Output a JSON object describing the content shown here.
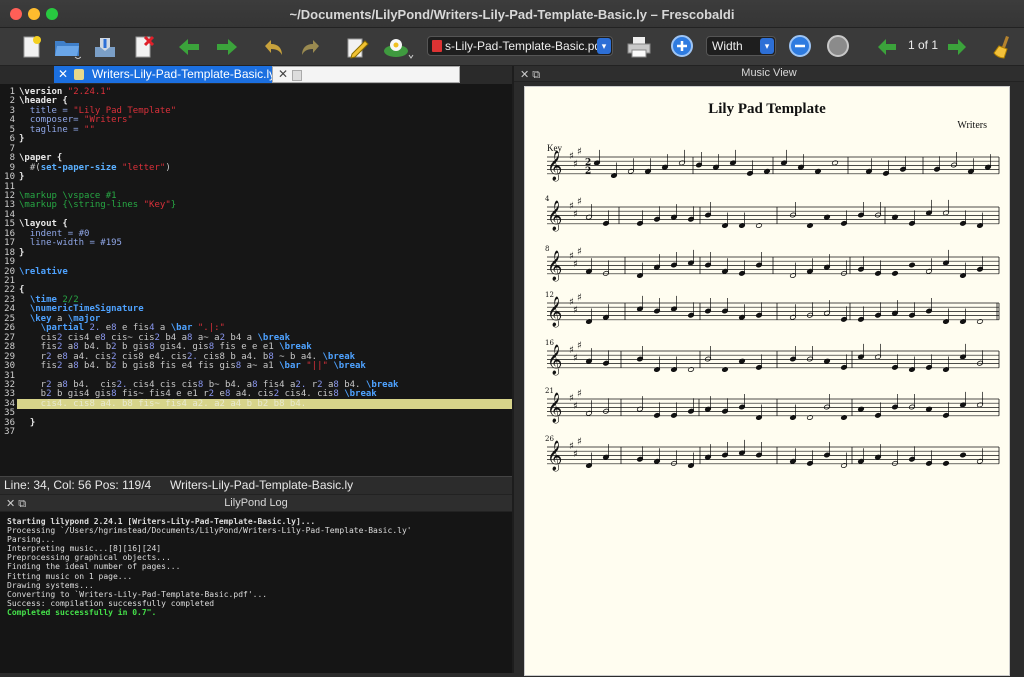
{
  "window": {
    "title": "~/Documents/LilyPond/Writers-Lily-Pad-Template-Basic.ly – Frescobaldi"
  },
  "toolbar": {
    "icons": [
      "new-document-icon",
      "open-folder-icon",
      "save-icon",
      "close-document-icon",
      "back-arrow-icon",
      "forward-arrow-icon",
      "undo-icon",
      "redo-icon",
      "edit-pencil-icon",
      "lilypond-run-icon",
      "print-icon",
      "zoom-in-icon",
      "zoom-out-icon",
      "zoom-original-icon",
      "prev-page-icon",
      "next-page-icon",
      "broom-icon"
    ],
    "document_select": "s-Lily-Pad-Template-Basic.pdf",
    "zoom_select": "Width",
    "page_indicator": "1 of 1"
  },
  "editor": {
    "tab_label": "Writers-Lily-Pad-Template-Basic.ly",
    "current_line": 34,
    "line_numbers": [
      "1",
      "2",
      "3",
      "4",
      "5",
      "6",
      "7",
      "8",
      "9",
      "10",
      "11",
      "12",
      "13",
      "14",
      "15",
      "16",
      "17",
      "18",
      "19",
      "20",
      "21",
      "22",
      "23",
      "24",
      "25",
      "26",
      "27",
      "28",
      "29",
      "30",
      "31",
      "32",
      "33",
      "34",
      "35",
      "36",
      "37"
    ],
    "lines": [
      [
        [
          "k",
          "\\version "
        ],
        [
          "s",
          "\"2.24.1\""
        ]
      ],
      [
        [
          "k",
          "\\header {"
        ]
      ],
      [
        [
          "v",
          "  title = "
        ],
        [
          "s",
          "\"Lily Pad Template\""
        ]
      ],
      [
        [
          "v",
          "  composer= "
        ],
        [
          "s",
          "\"Writers\""
        ]
      ],
      [
        [
          "v",
          "  tagline = "
        ],
        [
          "s",
          "\"\""
        ]
      ],
      [
        [
          "k",
          "}"
        ]
      ],
      [],
      [
        [
          "k",
          "\\paper {"
        ]
      ],
      [
        [
          "n",
          "  #("
        ],
        [
          "fn",
          "set-paper-size"
        ],
        [
          "s",
          " \"letter\""
        ],
        [
          "n",
          ")"
        ]
      ],
      [
        [
          "k",
          "}"
        ]
      ],
      [],
      [
        [
          "c",
          "\\markup \\vspace #1"
        ]
      ],
      [
        [
          "c",
          "\\markup {"
        ],
        [
          "c",
          "\\string-lines "
        ],
        [
          "s",
          "\"Key\""
        ],
        [
          "c",
          "}"
        ]
      ],
      [],
      [
        [
          "k",
          "\\layout {"
        ]
      ],
      [
        [
          "v",
          "  indent = #0"
        ]
      ],
      [
        [
          "v",
          "  line-width = #195"
        ]
      ],
      [
        [
          "k",
          "}"
        ]
      ],
      [],
      [
        [
          "kw",
          "\\relative"
        ]
      ],
      [],
      [
        [
          "k",
          "{"
        ]
      ],
      [
        [
          "kw",
          "  \\time "
        ],
        [
          "c",
          "2/2"
        ]
      ],
      [
        [
          "kw",
          "  \\numericTimeSignature"
        ]
      ],
      [
        [
          "kw",
          "  \\key "
        ],
        [
          "n",
          "a "
        ],
        [
          "kw",
          "\\major"
        ]
      ],
      [
        [
          "kw",
          "    \\partial "
        ],
        [
          "p",
          "2. "
        ],
        [
          "n",
          "e"
        ],
        [
          "p",
          "8 "
        ],
        [
          "n",
          "e fis"
        ],
        [
          "p",
          "4 "
        ],
        [
          "n",
          "a "
        ],
        [
          "kw",
          "\\bar "
        ],
        [
          "s",
          "\".|:\""
        ]
      ],
      [
        [
          "n",
          "    cis"
        ],
        [
          "p",
          "2 "
        ],
        [
          "n",
          "cis4 e"
        ],
        [
          "p",
          "8 "
        ],
        [
          "n",
          "cis~ cis"
        ],
        [
          "p",
          "2 "
        ],
        [
          "n",
          "b4 a"
        ],
        [
          "p",
          "8 "
        ],
        [
          "n",
          "a~ a"
        ],
        [
          "p",
          "2 "
        ],
        [
          "n",
          "b4 a "
        ],
        [
          "kw",
          "\\break"
        ]
      ],
      [
        [
          "n",
          "    fis"
        ],
        [
          "p",
          "2 "
        ],
        [
          "n",
          "a"
        ],
        [
          "p",
          "8 "
        ],
        [
          "n",
          "b4. b"
        ],
        [
          "p",
          "2 "
        ],
        [
          "n",
          "b gis"
        ],
        [
          "p",
          "8 "
        ],
        [
          "n",
          "gis4. gis"
        ],
        [
          "p",
          "8 "
        ],
        [
          "n",
          "fis e e e1 "
        ],
        [
          "kw",
          "\\break"
        ]
      ],
      [
        [
          "n",
          "    r"
        ],
        [
          "p",
          "2 "
        ],
        [
          "n",
          "e"
        ],
        [
          "p",
          "8 "
        ],
        [
          "n",
          "a4. cis"
        ],
        [
          "p",
          "2 "
        ],
        [
          "n",
          "cis8 e4. cis"
        ],
        [
          "p",
          "2. "
        ],
        [
          "n",
          "cis8 b a4. b"
        ],
        [
          "p",
          "8 "
        ],
        [
          "n",
          "~ b a4. "
        ],
        [
          "kw",
          "\\break"
        ]
      ],
      [
        [
          "n",
          "    fis"
        ],
        [
          "p",
          "2 "
        ],
        [
          "n",
          "a"
        ],
        [
          "p",
          "8 "
        ],
        [
          "n",
          "b4. b"
        ],
        [
          "p",
          "2 "
        ],
        [
          "n",
          "b gis8 fis e4 fis gis"
        ],
        [
          "p",
          "8 "
        ],
        [
          "n",
          "a~ a1 "
        ],
        [
          "kw",
          "\\bar "
        ],
        [
          "s",
          "\"||\""
        ],
        [
          "kw",
          " \\break"
        ]
      ],
      [],
      [
        [
          "n",
          "    r"
        ],
        [
          "p",
          "2 "
        ],
        [
          "n",
          "a"
        ],
        [
          "p",
          "8 "
        ],
        [
          "n",
          "b4.  cis"
        ],
        [
          "p",
          "2. "
        ],
        [
          "n",
          "cis4 cis cis"
        ],
        [
          "p",
          "8 "
        ],
        [
          "n",
          "b~ b4. a"
        ],
        [
          "p",
          "8 "
        ],
        [
          "n",
          "fis4 a"
        ],
        [
          "p",
          "2. "
        ],
        [
          "n",
          "r"
        ],
        [
          "p",
          "2 "
        ],
        [
          "n",
          "a"
        ],
        [
          "p",
          "8 "
        ],
        [
          "n",
          "b4. "
        ],
        [
          "kw",
          "\\break"
        ]
      ],
      [
        [
          "n",
          "    b"
        ],
        [
          "p",
          "2 "
        ],
        [
          "n",
          "b gis4 gis"
        ],
        [
          "p",
          "8 "
        ],
        [
          "n",
          "fis~ fis4 e e1 r"
        ],
        [
          "p",
          "2 "
        ],
        [
          "n",
          "e"
        ],
        [
          "p",
          "8 "
        ],
        [
          "n",
          "a4. cis"
        ],
        [
          "p",
          "2 "
        ],
        [
          "n",
          "cis4. cis"
        ],
        [
          "p",
          "8 "
        ],
        [
          "kw",
          "\\break"
        ]
      ],
      [
        [
          "dim",
          "    cis4. cis8 a4. b8 fis~ fis4 a2. a2 a4 b b2 b8 b4."
        ]
      ],
      [],
      [
        [
          "k",
          "  }"
        ]
      ],
      []
    ]
  },
  "status": {
    "position": "Line: 34, Col: 56  Pos: 119/4",
    "file": "Writers-Lily-Pad-Template-Basic.ly"
  },
  "log": {
    "title": "LilyPond Log",
    "lines": [
      "Starting lilypond 2.24.1 [Writers-Lily-Pad-Template-Basic.ly]...",
      "Processing `/Users/hgrimstead/Documents/LilyPond/Writers-Lily-Pad-Template-Basic.ly'",
      "Parsing...",
      "Interpreting music...[8][16][24]",
      "Preprocessing graphical objects...",
      "Finding the ideal number of pages...",
      "Fitting music on 1 page...",
      "Drawing systems...",
      "Converting to `Writers-Lily-Pad-Template-Basic.pdf'...",
      "Success: compilation successfully completed",
      "Completed successfully in 0.7\"."
    ]
  },
  "music_view": {
    "title": "Music View",
    "score_title": "Lily Pad Template",
    "composer": "Writers",
    "key_markup": "Key",
    "time_signature": "2/2",
    "key_signature": "A major",
    "measure_numbers": [
      "4",
      "8",
      "12",
      "16",
      "21",
      "26"
    ]
  }
}
